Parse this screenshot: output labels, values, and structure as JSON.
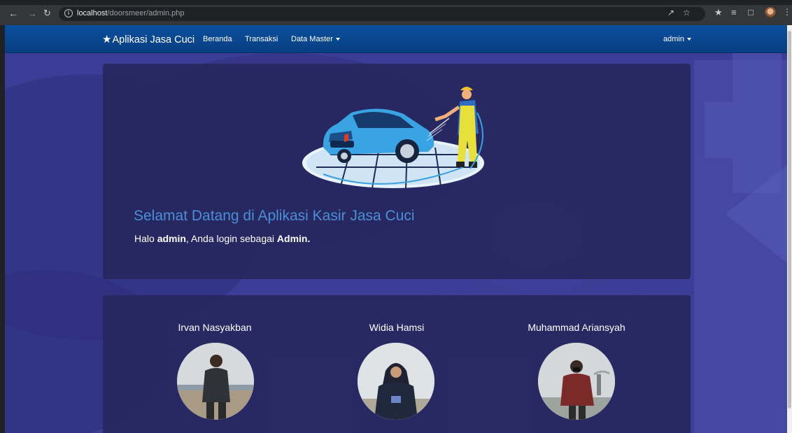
{
  "browser": {
    "url_host": "localhost",
    "url_path": "/doorsmeer/admin.php",
    "icons": [
      "back-icon",
      "forward-icon",
      "reload-icon",
      "info-icon",
      "share-icon",
      "bookmark-star-icon",
      "extensions-icon",
      "reading-list-icon",
      "side-panel-icon",
      "profile-avatar",
      "menu-icon"
    ]
  },
  "navbar": {
    "brand": "Aplikasi Jasa Cuci",
    "links": [
      "Beranda",
      "Transaksi",
      "Data Master"
    ],
    "user_menu": "admin"
  },
  "hero": {
    "title": "Selamat Datang di Aplikasi Kasir Jasa Cuci",
    "greeting_prefix": "Halo ",
    "greeting_user": "admin",
    "greeting_middle": ", Anda login sebagai ",
    "greeting_role": "Admin."
  },
  "team": [
    {
      "name": "Irvan Nasyakban"
    },
    {
      "name": "Widia Hamsi"
    },
    {
      "name": "Muhammad Ariansyah"
    }
  ],
  "colors": {
    "navbar": "#0b4f9e",
    "page_background": "#3b3d97",
    "panel": "#26265c",
    "welcome_text": "#4b8fd6"
  }
}
